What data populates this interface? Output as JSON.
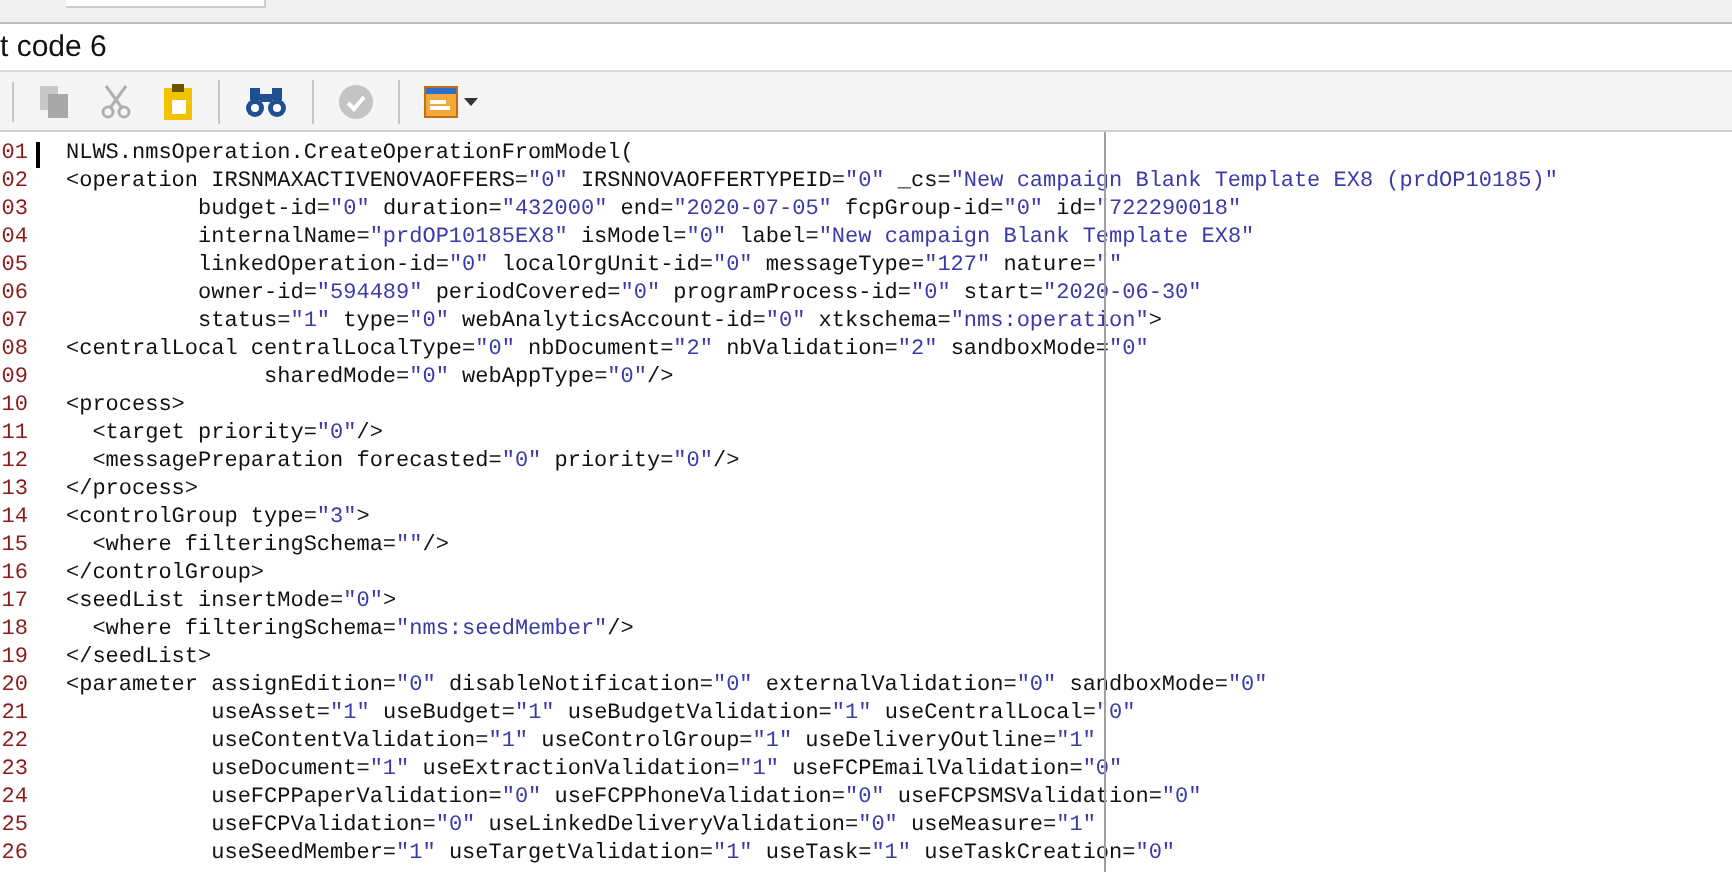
{
  "title_field": {
    "value": "t code 6"
  },
  "toolbar": [
    {
      "kind": "copy",
      "disabled": true
    },
    {
      "kind": "cut",
      "disabled": true
    },
    {
      "kind": "paste",
      "disabled": false
    },
    {
      "kind": "sep"
    },
    {
      "kind": "find",
      "disabled": false
    },
    {
      "kind": "sep"
    },
    {
      "kind": "check",
      "disabled": true
    },
    {
      "kind": "sep"
    },
    {
      "kind": "window",
      "disabled": false
    }
  ],
  "editor": {
    "lines": [
      {
        "number": "01",
        "text": "NLWS.nmsOperation.CreateOperationFromModel("
      },
      {
        "number": "02",
        "text": "<operation IRSNMAXACTIVENOVAOFFERS=\"0\" IRSNNOVAOFFERTYPEID=\"0\" _cs=\"New campaign Blank Template EX8 (prdOP10185)\""
      },
      {
        "number": "03",
        "text": "          budget-id=\"0\" duration=\"432000\" end=\"2020-07-05\" fcpGroup-id=\"0\" id=\"722290018\""
      },
      {
        "number": "04",
        "text": "          internalName=\"prdOP10185EX8\" isModel=\"0\" label=\"New campaign Blank Template EX8\""
      },
      {
        "number": "05",
        "text": "          linkedOperation-id=\"0\" localOrgUnit-id=\"0\" messageType=\"127\" nature=\"\""
      },
      {
        "number": "06",
        "text": "          owner-id=\"594489\" periodCovered=\"0\" programProcess-id=\"0\" start=\"2020-06-30\""
      },
      {
        "number": "07",
        "text": "          status=\"1\" type=\"0\" webAnalyticsAccount-id=\"0\" xtkschema=\"nms:operation\">"
      },
      {
        "number": "08",
        "text": "<centralLocal centralLocalType=\"0\" nbDocument=\"2\" nbValidation=\"2\" sandboxMode=\"0\""
      },
      {
        "number": "09",
        "text": "               sharedMode=\"0\" webAppType=\"0\"/>"
      },
      {
        "number": "10",
        "text": "<process>"
      },
      {
        "number": "11",
        "text": "  <target priority=\"0\"/>"
      },
      {
        "number": "12",
        "text": "  <messagePreparation forecasted=\"0\" priority=\"0\"/>"
      },
      {
        "number": "13",
        "text": "</process>"
      },
      {
        "number": "14",
        "text": "<controlGroup type=\"3\">"
      },
      {
        "number": "15",
        "text": "  <where filteringSchema=\"\"/>"
      },
      {
        "number": "16",
        "text": "</controlGroup>"
      },
      {
        "number": "17",
        "text": "<seedList insertMode=\"0\">"
      },
      {
        "number": "18",
        "text": "  <where filteringSchema=\"nms:seedMember\"/>"
      },
      {
        "number": "19",
        "text": "</seedList>"
      },
      {
        "number": "20",
        "text": "<parameter assignEdition=\"0\" disableNotification=\"0\" externalValidation=\"0\" sandboxMode=\"0\""
      },
      {
        "number": "21",
        "text": "           useAsset=\"1\" useBudget=\"1\" useBudgetValidation=\"1\" useCentralLocal=\"0\""
      },
      {
        "number": "22",
        "text": "           useContentValidation=\"1\" useControlGroup=\"1\" useDeliveryOutline=\"1\""
      },
      {
        "number": "23",
        "text": "           useDocument=\"1\" useExtractionValidation=\"1\" useFCPEmailValidation=\"0\""
      },
      {
        "number": "24",
        "text": "           useFCPPaperValidation=\"0\" useFCPPhoneValidation=\"0\" useFCPSMSValidation=\"0\""
      },
      {
        "number": "25",
        "text": "           useFCPValidation=\"0\" useLinkedDeliveryValidation=\"0\" useMeasure=\"1\""
      },
      {
        "number": "26",
        "text": "           useSeedMember=\"1\" useTargetValidation=\"1\" useTask=\"1\" useTaskCreation=\"0\""
      }
    ]
  }
}
